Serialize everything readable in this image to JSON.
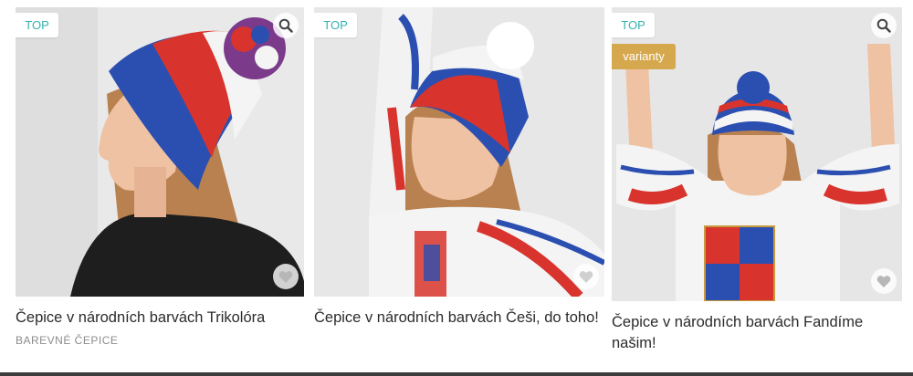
{
  "products": [
    {
      "title": "Čepice v národních barvách Trikolóra",
      "category": "BAREVNÉ ČEPICE",
      "badge_top": "TOP",
      "icons": {
        "zoom": "search-icon",
        "favorite": "heart-icon"
      }
    },
    {
      "title": "Čepice v národních barvách Češi, do toho!",
      "badge_top": "TOP",
      "icons": {
        "favorite": "heart-icon"
      }
    },
    {
      "title": "Čepice v národních barvách Fandíme našim!",
      "badge_top": "TOP",
      "badge_variant": "varianty",
      "icons": {
        "zoom": "search-icon",
        "favorite": "heart-icon"
      }
    }
  ],
  "colors": {
    "badge_text": "#36b2b0",
    "variant_badge": "#d6a84d",
    "hat_blue": "#2b4fb0",
    "hat_red": "#d8342d",
    "hat_white": "#f4f4f4"
  }
}
